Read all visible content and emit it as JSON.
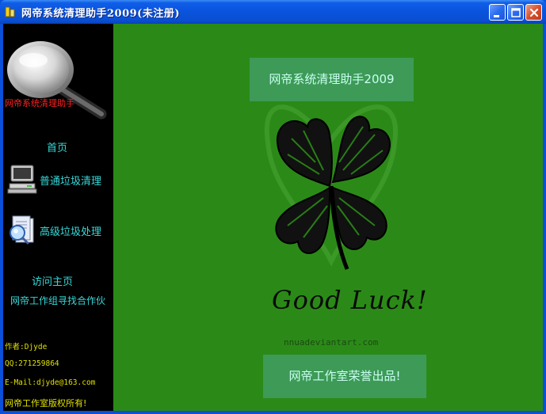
{
  "window": {
    "title": "网帝系统清理助手2009(未注册)",
    "controls": {
      "minimize_icon": "minimize-icon",
      "maximize_icon": "maximize-icon",
      "close_icon": "close-icon"
    }
  },
  "sidebar": {
    "app_label": "网帝系统清理助手",
    "nav": {
      "home": "首页",
      "normal_clean": "普通垃圾清理",
      "advanced_clean": "高级垃圾处理",
      "visit_homepage": "访问主页",
      "find_partner": "网帝工作组寻找合作伙"
    },
    "info": {
      "author": "作者:Djyde",
      "qq": "QQ:271259864",
      "email": "E-Mail:djyde@163.com",
      "copyright": "网帝工作室版权所有!"
    }
  },
  "main": {
    "top_banner": "网帝系统清理助手2009",
    "image_caption": "Good Luck!",
    "image_credit": "nnuadeviantart.com",
    "bottom_banner": "网帝工作室荣誉出品!"
  },
  "colors": {
    "sidebar_bg": "#000000",
    "main_bg": "#2b8a17",
    "nav_text": "#38d8d8",
    "info_text": "#e0e000",
    "app_label": "#ff2020",
    "banner_bg": "#3d9a57"
  }
}
